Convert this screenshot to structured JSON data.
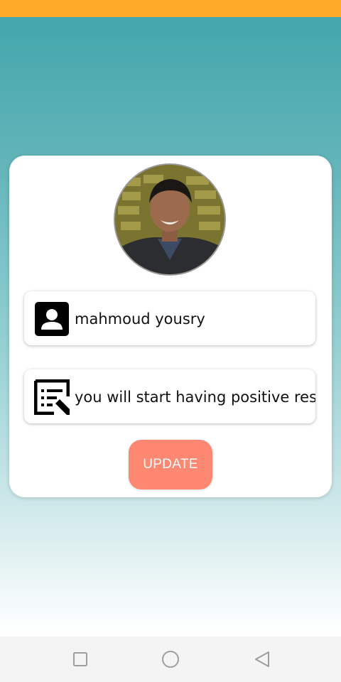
{
  "status_bar": {
    "color": "#ffa929"
  },
  "profile": {
    "avatar": "profile-photo",
    "name_icon": "account-box-icon",
    "name": "mahmoud yousry",
    "bio_icon": "edit-note-icon",
    "bio": "you will start having positive resu",
    "update_label": "UPDATE",
    "update_color": "#fd8770"
  },
  "nav": {
    "recent_icon": "square-icon",
    "home_icon": "circle-icon",
    "back_icon": "triangle-back-icon"
  }
}
